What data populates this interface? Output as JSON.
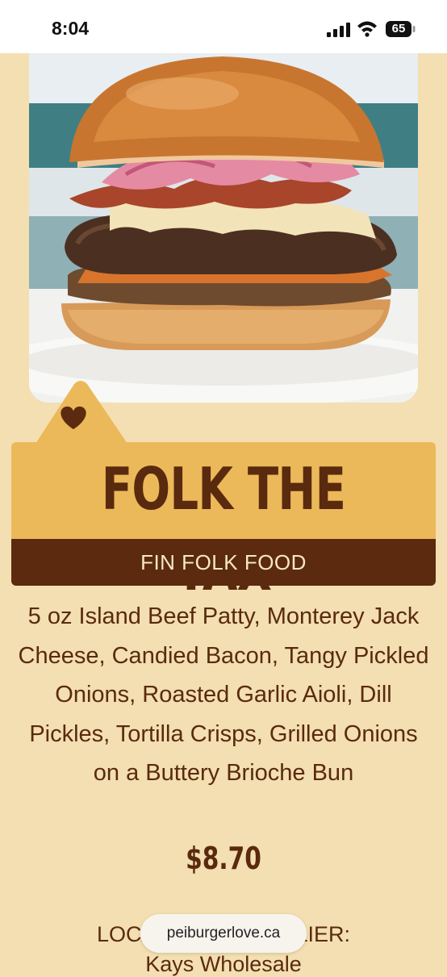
{
  "status_bar": {
    "time": "8:04",
    "battery": "65",
    "icons": [
      "signal-icon",
      "wifi-icon",
      "battery-icon"
    ]
  },
  "image": {
    "alt": "burger-photo"
  },
  "menu_item": {
    "title": "FOLK THE TAX",
    "restaurant": "FIN FOLK FOOD",
    "description": "5 oz Island Beef Patty, Monterey Jack Cheese, Candied Bacon, Tangy Pickled Onions, Roasted Garlic Aioli, Dill Pickles, Tortilla Crisps, Grilled Onions on a Buttery Brioche Bun",
    "price": "$8.70",
    "supplier_label": "LOCAL BEEF SUPPLIER:",
    "supplier_name": "Kays Wholesale"
  },
  "browser": {
    "url": "peiburgerlove.ca"
  },
  "colors": {
    "background": "#f3dfb1",
    "title_band": "#ecb95a",
    "brand_band": "#5b2a0f",
    "text": "#5a2a0e"
  }
}
